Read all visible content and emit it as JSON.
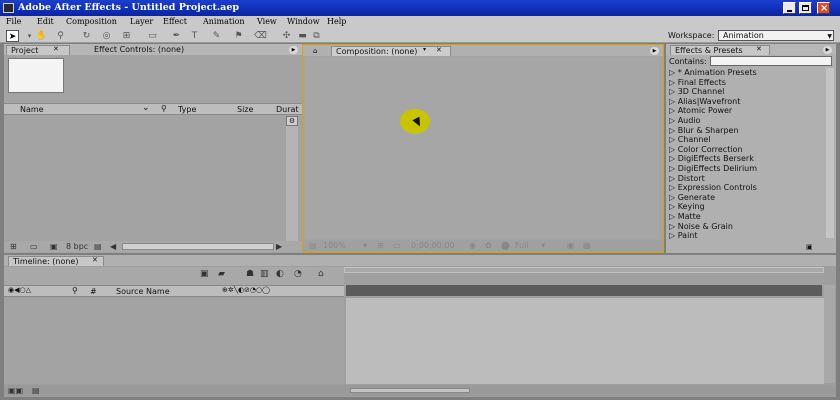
{
  "window": {
    "title": "Adobe After Effects - Untitled Project.aep"
  },
  "menu": [
    "File",
    "Edit",
    "Composition",
    "Layer",
    "Effect",
    "Animation",
    "View",
    "Window",
    "Help"
  ],
  "toolbar": {
    "workspace_label": "Workspace:",
    "workspace_value": "Animation"
  },
  "project_panel": {
    "tab_project": "Project",
    "tab_effect_controls": "Effect Controls: (none)",
    "columns": [
      "Name",
      "Type",
      "Size",
      "Durat"
    ],
    "bpc_label": "8 bpc"
  },
  "composition_panel": {
    "tab": "Composition: (none)",
    "zoom": "100%",
    "timecode": "0;00;00;00",
    "resolution": "Full"
  },
  "effects_panel": {
    "tab": "Effects & Presets",
    "contains_label": "Contains:",
    "items": [
      "* Animation Presets",
      "Final Effects",
      "3D Channel",
      "Alias|Wavefront",
      "Atomic Power",
      "Audio",
      "Blur & Sharpen",
      "Channel",
      "Color Correction",
      "DigiEffects Berserk",
      "DigiEffects Delirium",
      "Distort",
      "Expression Controls",
      "Generate",
      "Keying",
      "Matte",
      "Noise & Grain",
      "Paint"
    ]
  },
  "timeline_panel": {
    "tab": "Timeline: (none)",
    "source_name": "Source Name",
    "hash": "#"
  }
}
